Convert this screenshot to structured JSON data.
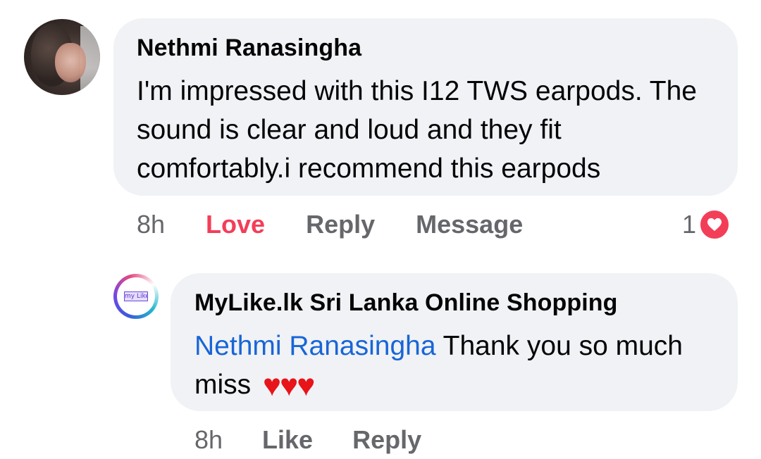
{
  "comment": {
    "author": "Nethmi Ranasingha",
    "text": "I'm impressed with this I12 TWS earpods. The sound is clear and loud and they fit comfortably.i recommend this earpods",
    "time": "8h",
    "actions": {
      "love": "Love",
      "reply": "Reply",
      "message": "Message"
    },
    "reaction_count": "1",
    "reaction_icon": "love-reaction-icon",
    "love_color": "#f33e58"
  },
  "reply": {
    "author": "MyLike.lk Sri Lanka Online Shopping",
    "avatar_text": "my Like",
    "mention": "Nethmi Ranasingha",
    "text": " Thank you so much miss ",
    "hearts": "♥♥♥",
    "time": "8h",
    "actions": {
      "like": "Like",
      "reply": "Reply"
    },
    "mention_color": "#1865d6"
  }
}
